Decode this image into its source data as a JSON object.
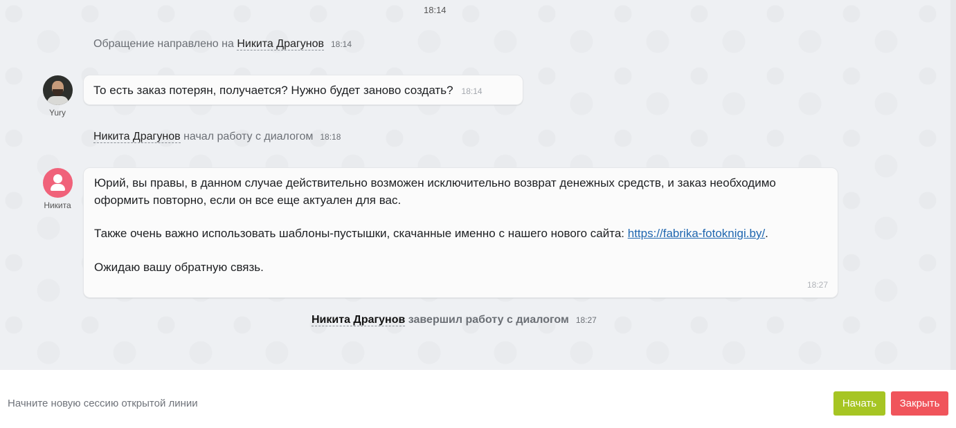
{
  "chat": {
    "top_time": "18:14",
    "events": [
      {
        "prefix": "Обращение направлено на",
        "name": "Никита Драгунов",
        "suffix": "",
        "time": "18:14"
      },
      {
        "prefix": "",
        "name": "Никита Драгунов",
        "suffix": "начал работу с диалогом",
        "time": "18:18"
      },
      {
        "prefix": "",
        "name": "Никита Драгунов",
        "suffix": "завершил работу с диалогом",
        "time": "18:27"
      }
    ],
    "messages": [
      {
        "author": "Yury",
        "text": "То есть заказ потерян, получается? Нужно будет заново создать?",
        "time": "18:14"
      },
      {
        "author": "Никита",
        "paragraph1": "Юрий, вы правы, в данном случае действительно возможен исключительно возврат денежных средств, и заказ необходимо оформить повторно, если он все еще актуален для вас.",
        "paragraph2_prefix": "Также очень важно использовать шаблоны-пустышки, скачанные именно с нашего нового сайта: ",
        "link_text": "https://fabrika-fotoknigi.by/",
        "paragraph2_suffix": ".",
        "paragraph3": "Ожидаю вашу обратную связь.",
        "time": "18:27"
      }
    ]
  },
  "footer": {
    "prompt": "Начните новую сессию открытой линии",
    "start_label": "Начать",
    "close_label": "Закрыть"
  },
  "colors": {
    "start_button": "#a6c523",
    "close_button": "#f0545b",
    "avatar_nikita": "#f0627a",
    "link": "#2067b0"
  }
}
